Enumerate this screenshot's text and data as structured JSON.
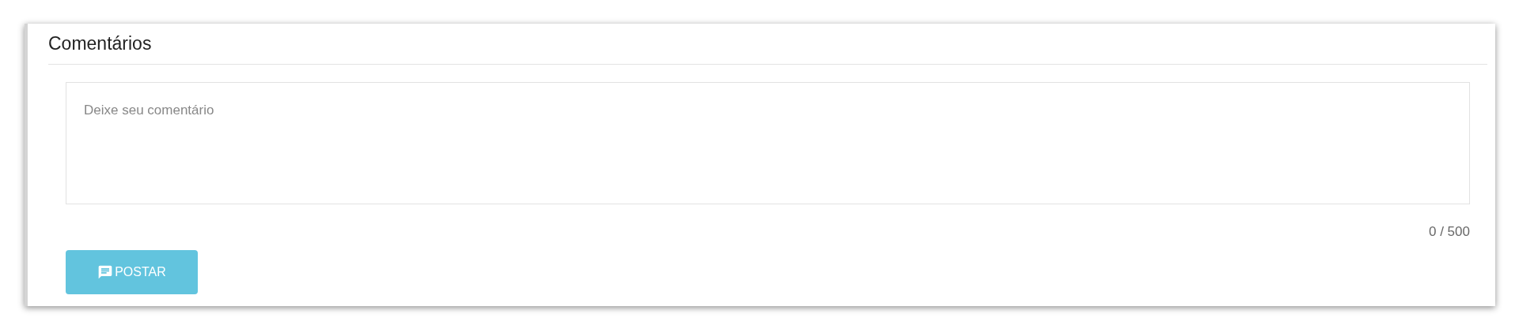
{
  "title": "Comentários",
  "comment_field": {
    "placeholder": "Deixe seu comentário"
  },
  "counter": "0 / 500",
  "post_button": {
    "label": "POSTAR"
  }
}
